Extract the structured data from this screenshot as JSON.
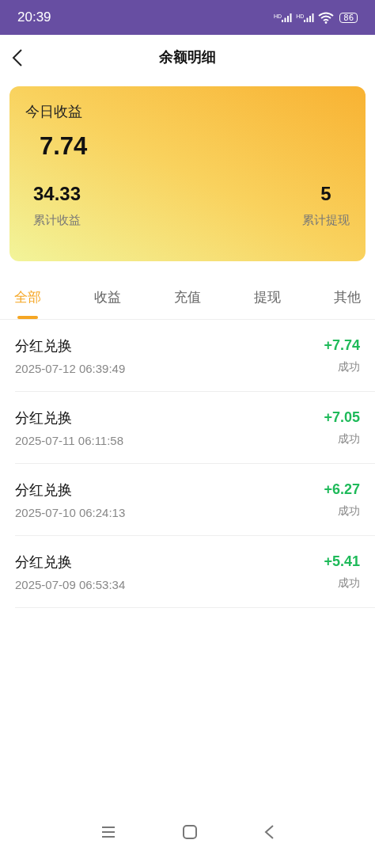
{
  "status_bar": {
    "time": "20:39",
    "signal_labels": [
      "HD",
      "HD"
    ],
    "battery": "86"
  },
  "header": {
    "title": "余额明细"
  },
  "summary": {
    "today_label": "今日收益",
    "today_value": "7.74",
    "stats": [
      {
        "value": "34.33",
        "label": "累计收益"
      },
      {
        "value": "5",
        "label": "累计提现"
      }
    ]
  },
  "tabs": [
    {
      "label": "全部",
      "selected": true
    },
    {
      "label": "收益",
      "selected": false
    },
    {
      "label": "充值",
      "selected": false
    },
    {
      "label": "提现",
      "selected": false
    },
    {
      "label": "其他",
      "selected": false
    }
  ],
  "records": [
    {
      "title": "分红兑换",
      "time": "2025-07-12 06:39:49",
      "amount": "+7.74",
      "status": "成功"
    },
    {
      "title": "分红兑换",
      "time": "2025-07-11 06:11:58",
      "amount": "+7.05",
      "status": "成功"
    },
    {
      "title": "分红兑换",
      "time": "2025-07-10 06:24:13",
      "amount": "+6.27",
      "status": "成功"
    },
    {
      "title": "分红兑换",
      "time": "2025-07-09 06:53:34",
      "amount": "+5.41",
      "status": "成功"
    }
  ]
}
